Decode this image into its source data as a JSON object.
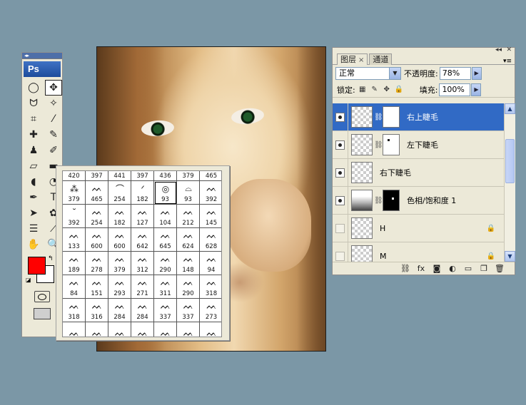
{
  "toolbox": {
    "logo": "Ps",
    "grip": "◂▸",
    "tools": [
      {
        "name": "marquee-icon",
        "glyph": "◯"
      },
      {
        "name": "move-icon",
        "glyph": "✥"
      },
      {
        "name": "lasso-icon",
        "glyph": "ᗢ"
      },
      {
        "name": "magic-wand-icon",
        "glyph": "✧"
      },
      {
        "name": "crop-icon",
        "glyph": "⌗"
      },
      {
        "name": "slice-icon",
        "glyph": "⁄"
      },
      {
        "name": "healing-brush-icon",
        "glyph": "✚"
      },
      {
        "name": "brush-icon",
        "glyph": "✎"
      },
      {
        "name": "clone-stamp-icon",
        "glyph": "♟"
      },
      {
        "name": "history-brush-icon",
        "glyph": "✐"
      },
      {
        "name": "eraser-icon",
        "glyph": "▱"
      },
      {
        "name": "gradient-icon",
        "glyph": "▬"
      },
      {
        "name": "blur-icon",
        "glyph": "◖"
      },
      {
        "name": "dodge-icon",
        "glyph": "◔"
      },
      {
        "name": "pen-icon",
        "glyph": "✒"
      },
      {
        "name": "type-icon",
        "glyph": "T"
      },
      {
        "name": "path-selection-icon",
        "glyph": "➤"
      },
      {
        "name": "custom-shape-icon",
        "glyph": "✿"
      },
      {
        "name": "notes-icon",
        "glyph": "☰"
      },
      {
        "name": "eyedropper-icon",
        "glyph": "⟋"
      },
      {
        "name": "hand-icon",
        "glyph": "✋"
      },
      {
        "name": "zoom-icon",
        "glyph": "🔍"
      }
    ],
    "foreground_color": "#ff0000",
    "background_color": "#ffffff",
    "swap_glyph": "↰",
    "default_glyph": "◪"
  },
  "brushes": {
    "header_row": [
      "420",
      "397",
      "441",
      "397",
      "436",
      "379",
      "465"
    ],
    "rows": [
      [
        {
          "n": "379",
          "m": "⁂"
        },
        {
          "n": "465",
          "m": "ᨓ"
        },
        {
          "n": "254",
          "m": "⌒"
        },
        {
          "n": "182",
          "m": "ᐟ"
        },
        {
          "n": "93",
          "m": "◎"
        },
        {
          "n": "93",
          "m": "⌓"
        },
        {
          "n": "392",
          "m": "ᨓ"
        }
      ],
      [
        {
          "n": "392",
          "m": "˘"
        },
        {
          "n": "254",
          "m": "ᨓ"
        },
        {
          "n": "182",
          "m": "ᨓ"
        },
        {
          "n": "127",
          "m": "ᨓ"
        },
        {
          "n": "104",
          "m": "ᨓ"
        },
        {
          "n": "212",
          "m": "ᨓ"
        },
        {
          "n": "145",
          "m": "ᨓ"
        }
      ],
      [
        {
          "n": "133",
          "m": "ᨓ"
        },
        {
          "n": "600",
          "m": "ᨓ"
        },
        {
          "n": "600",
          "m": "ᨓ"
        },
        {
          "n": "642",
          "m": "ᨓ"
        },
        {
          "n": "645",
          "m": "ᨓ"
        },
        {
          "n": "624",
          "m": "ᨓ"
        },
        {
          "n": "628",
          "m": "ᨓ"
        }
      ],
      [
        {
          "n": "189",
          "m": "ᨓ"
        },
        {
          "n": "278",
          "m": "ᨓ"
        },
        {
          "n": "379",
          "m": "ᨓ"
        },
        {
          "n": "312",
          "m": "ᨓ"
        },
        {
          "n": "290",
          "m": "ᨓ"
        },
        {
          "n": "148",
          "m": "ᨓ"
        },
        {
          "n": "94",
          "m": "ᨓ"
        }
      ],
      [
        {
          "n": "84",
          "m": "ᨓ"
        },
        {
          "n": "151",
          "m": "ᨓ"
        },
        {
          "n": "293",
          "m": "ᨓ"
        },
        {
          "n": "271",
          "m": "ᨓ"
        },
        {
          "n": "311",
          "m": "ᨓ"
        },
        {
          "n": "290",
          "m": "ᨓ"
        },
        {
          "n": "318",
          "m": "ᨓ"
        }
      ],
      [
        {
          "n": "318",
          "m": "ᨓ"
        },
        {
          "n": "316",
          "m": "ᨓ"
        },
        {
          "n": "284",
          "m": "ᨓ"
        },
        {
          "n": "284",
          "m": "ᨓ"
        },
        {
          "n": "337",
          "m": "ᨓ"
        },
        {
          "n": "337",
          "m": "ᨓ"
        },
        {
          "n": "273",
          "m": "ᨓ"
        }
      ],
      [
        {
          "n": "",
          "m": "ᨓ"
        },
        {
          "n": "",
          "m": "ᨓ"
        },
        {
          "n": "",
          "m": "ᨓ"
        },
        {
          "n": "",
          "m": "ᨓ"
        },
        {
          "n": "",
          "m": "ᨓ"
        },
        {
          "n": "",
          "m": "ᨓ"
        },
        {
          "n": "",
          "m": "ᨓ"
        }
      ]
    ],
    "selected_index": 4
  },
  "layers_panel": {
    "title_controls": {
      "collapse": "◂◂",
      "close": "✕"
    },
    "tabs": [
      {
        "label": "图层",
        "close": "×",
        "active": true
      },
      {
        "label": "通道",
        "close": "",
        "active": false
      }
    ],
    "menu_glyph": "▾≡",
    "blend_mode": "正常",
    "opacity_label": "不透明度:",
    "opacity_value": "78%",
    "lock_label": "锁定:",
    "fill_label": "填充:",
    "fill_value": "100%",
    "layers": [
      {
        "name": "右上睫毛",
        "visible": true,
        "selected": true,
        "mask": "white",
        "mask_dot": false,
        "thumb": "transparent",
        "locked": false
      },
      {
        "name": "左下睫毛",
        "visible": true,
        "selected": false,
        "mask": "white",
        "mask_dot": true,
        "thumb": "transparent",
        "locked": false
      },
      {
        "name": "右下睫毛",
        "visible": true,
        "selected": false,
        "mask": "none",
        "mask_dot": false,
        "thumb": "transparent",
        "locked": false
      },
      {
        "name": "色相/饱和度 1",
        "visible": true,
        "selected": false,
        "mask": "black",
        "mask_dot": true,
        "thumb": "adjust",
        "locked": false
      },
      {
        "name": "H",
        "visible": false,
        "selected": false,
        "mask": "none",
        "mask_dot": false,
        "thumb": "transparent",
        "locked": true
      },
      {
        "name": "M",
        "visible": false,
        "selected": false,
        "mask": "none",
        "mask_dot": false,
        "thumb": "transparent",
        "locked": true
      }
    ],
    "bottom_icons": [
      {
        "name": "link-layers-icon",
        "glyph": "⛓"
      },
      {
        "name": "layer-style-icon",
        "glyph": "fx"
      },
      {
        "name": "add-mask-icon",
        "glyph": "◙"
      },
      {
        "name": "adjustment-layer-icon",
        "glyph": "◐"
      },
      {
        "name": "new-group-icon",
        "glyph": "▭"
      },
      {
        "name": "new-layer-icon",
        "glyph": "❐"
      },
      {
        "name": "delete-layer-icon",
        "glyph": "🗑"
      }
    ]
  }
}
